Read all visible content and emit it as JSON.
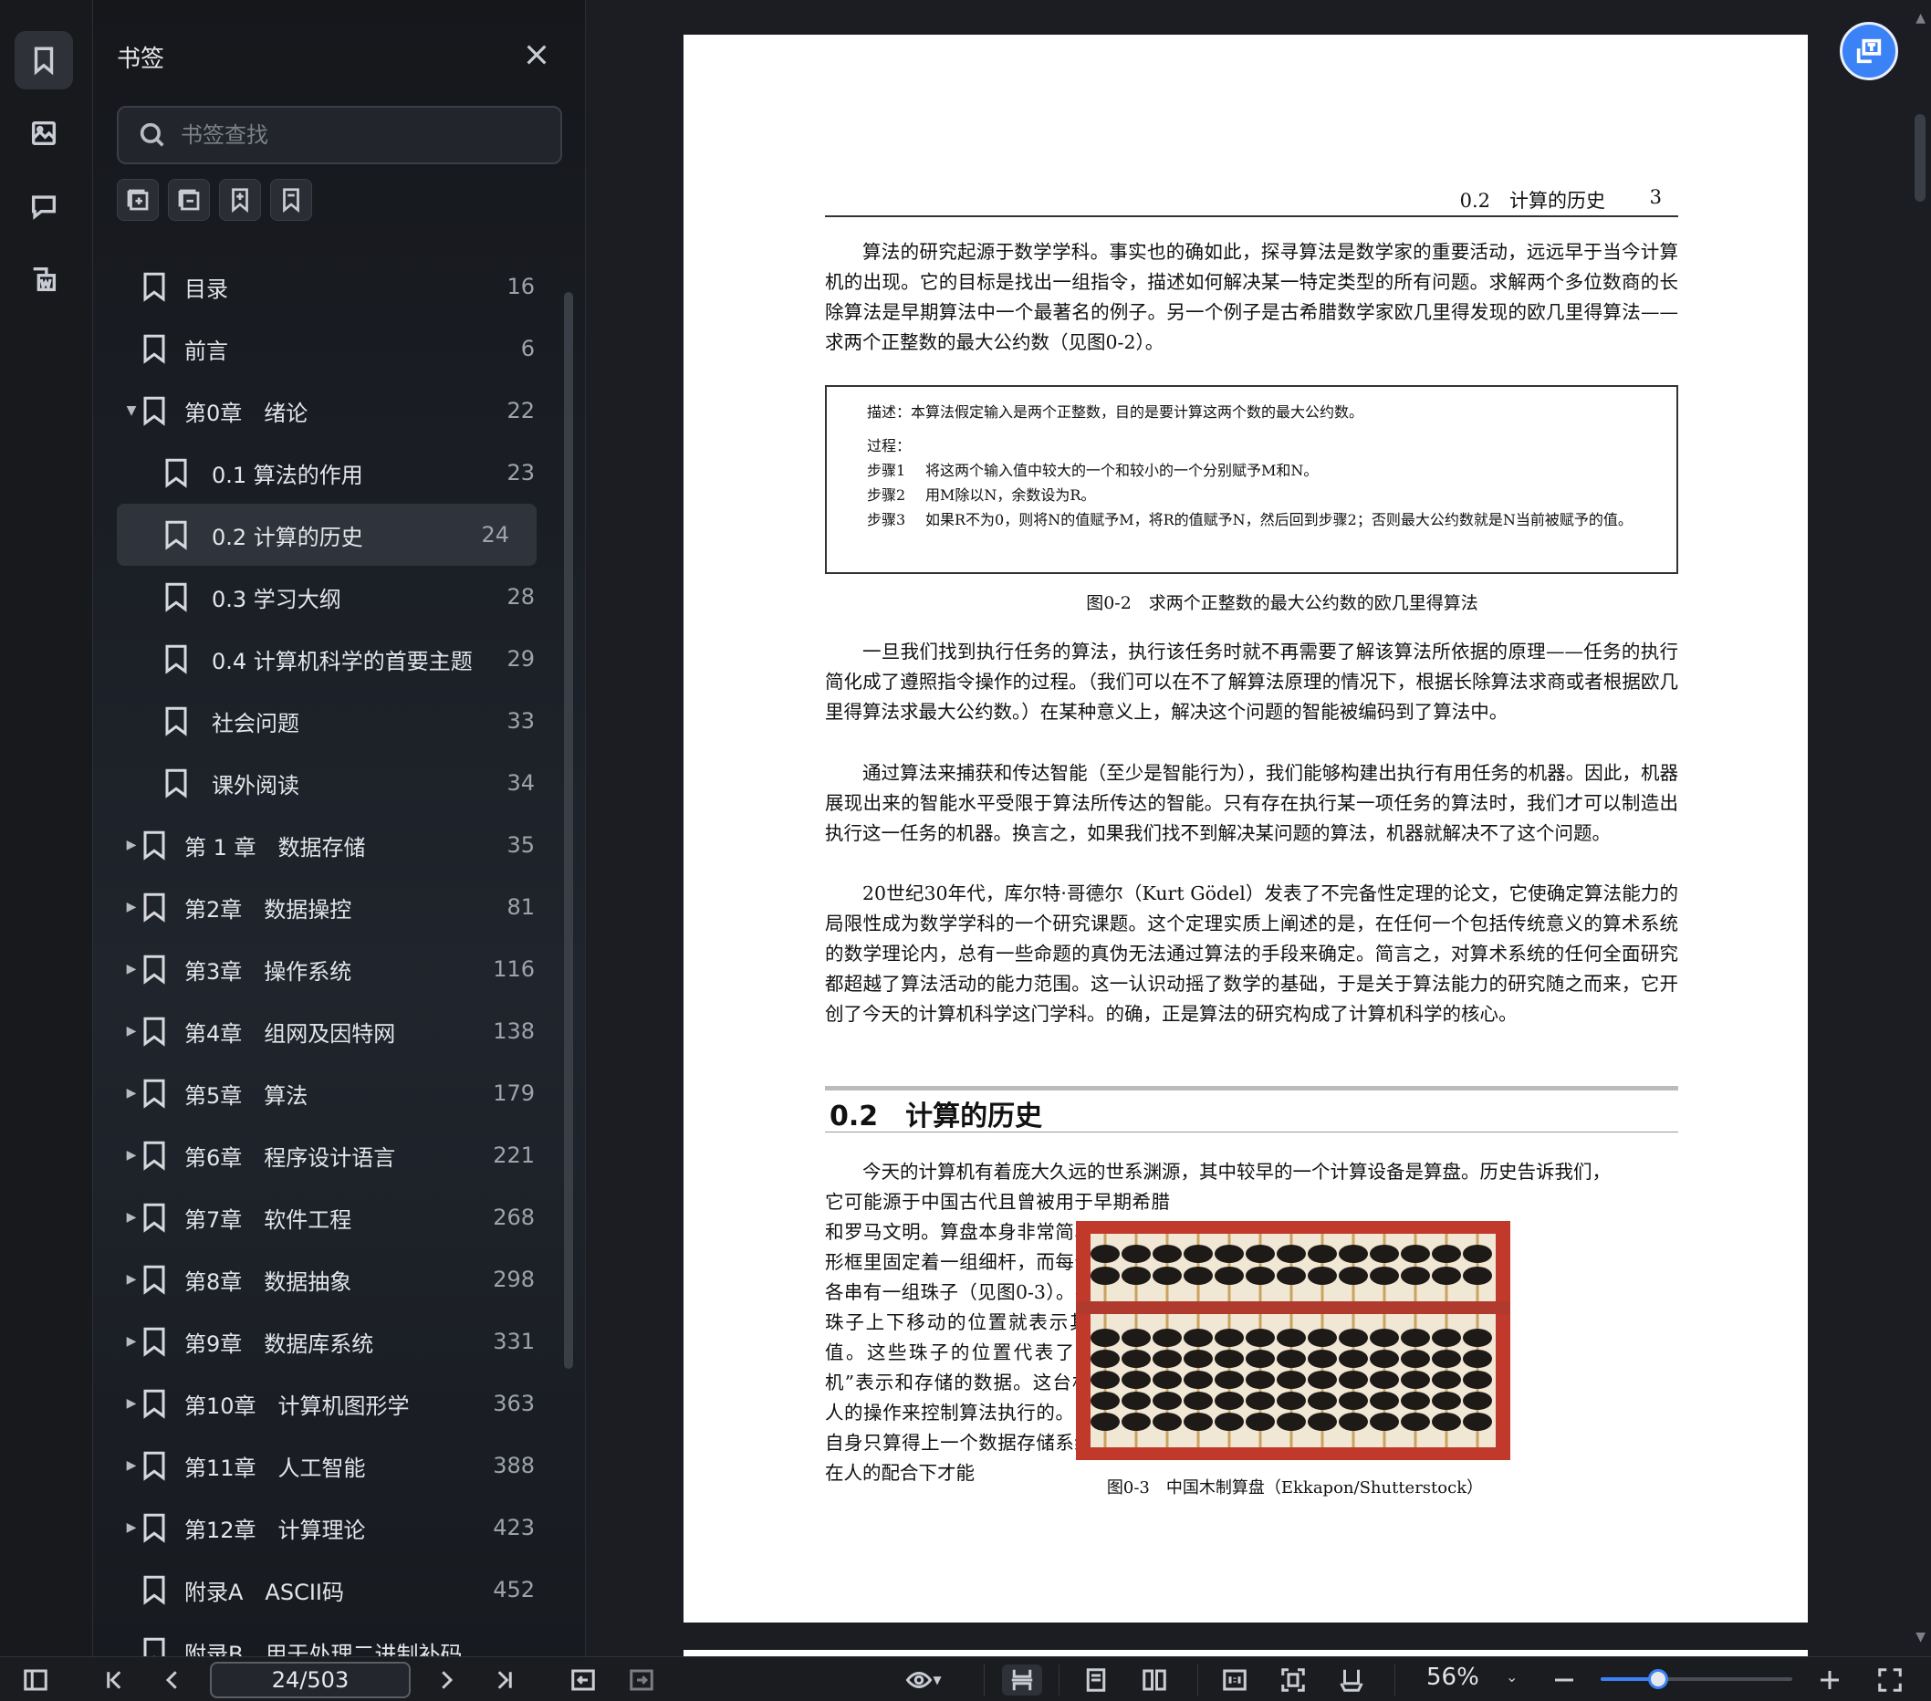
{
  "panel": {
    "title": "书签",
    "search_placeholder": "书签查找"
  },
  "bookmarks": [
    {
      "label": "目录",
      "page": "16",
      "level": 0,
      "arrow": ""
    },
    {
      "label": "前言",
      "page": "6",
      "level": 0,
      "arrow": ""
    },
    {
      "label": "第0章　绪论",
      "page": "22",
      "level": 0,
      "arrow": "▼"
    },
    {
      "label": "0.1 算法的作用",
      "page": "23",
      "level": 1,
      "arrow": ""
    },
    {
      "label": "0.2 计算的历史",
      "page": "24",
      "level": 1,
      "arrow": "",
      "selected": true
    },
    {
      "label": "0.3 学习大纲",
      "page": "28",
      "level": 1,
      "arrow": ""
    },
    {
      "label": "0.4 计算机科学的首要主题",
      "page": "29",
      "level": 1,
      "arrow": ""
    },
    {
      "label": "社会问题",
      "page": "33",
      "level": 1,
      "arrow": ""
    },
    {
      "label": "课外阅读",
      "page": "34",
      "level": 1,
      "arrow": ""
    },
    {
      "label": "第 1 章　数据存储",
      "page": "35",
      "level": 0,
      "arrow": "▶"
    },
    {
      "label": "第2章　数据操控",
      "page": "81",
      "level": 0,
      "arrow": "▶"
    },
    {
      "label": "第3章　操作系统",
      "page": "116",
      "level": 0,
      "arrow": "▶"
    },
    {
      "label": "第4章　组网及因特网",
      "page": "138",
      "level": 0,
      "arrow": "▶"
    },
    {
      "label": "第5章　算法",
      "page": "179",
      "level": 0,
      "arrow": "▶"
    },
    {
      "label": "第6章　程序设计语言",
      "page": "221",
      "level": 0,
      "arrow": "▶"
    },
    {
      "label": "第7章　软件工程",
      "page": "268",
      "level": 0,
      "arrow": "▶"
    },
    {
      "label": "第8章　数据抽象",
      "page": "298",
      "level": 0,
      "arrow": "▶"
    },
    {
      "label": "第9章　数据库系统",
      "page": "331",
      "level": 0,
      "arrow": "▶"
    },
    {
      "label": "第10章　计算机图形学",
      "page": "363",
      "level": 0,
      "arrow": "▶"
    },
    {
      "label": "第11章　人工智能",
      "page": "388",
      "level": 0,
      "arrow": "▶"
    },
    {
      "label": "第12章　计算理论",
      "page": "423",
      "level": 0,
      "arrow": "▶"
    },
    {
      "label": "附录A　ASCII码",
      "page": "452",
      "level": 0,
      "arrow": ""
    },
    {
      "label": "附录B　用于处理二进制补码",
      "page": "",
      "level": 0,
      "arrow": ""
    }
  ],
  "document": {
    "running_head_title": "0.2　计算的历史",
    "running_head_page": "3",
    "para1": "算法的研究起源于数学学科。事实也的确如此，探寻算法是数学家的重要活动，远远早于当今计算机的出现。它的目标是找出一组指令，描述如何解决某一特定类型的所有问题。求解两个多位数商的长除算法是早期算法中一个最著名的例子。另一个例子是古希腊数学家欧几里得发现的欧几里得算法——求两个正整数的最大公约数（见图0-2）。",
    "algo_desc": "描述：本算法假定输入是两个正整数，目的是要计算这两个数的最大公约数。",
    "algo_process": "过程：",
    "step1_label": "步骤1",
    "step1_text": "将这两个输入值中较大的一个和较小的一个分别赋予M和N。",
    "step2_label": "步骤2",
    "step2_text": "用M除以N，余数设为R。",
    "step3_label": "步骤3",
    "step3_text": "如果R不为0，则将N的值赋予M，将R的值赋予N，然后回到步骤2；否则最大公约数就是N当前被赋予的值。",
    "fig02_caption": "图0-2　求两个正整数的最大公约数的欧几里得算法",
    "para2": "一旦我们找到执行任务的算法，执行该任务时就不再需要了解该算法所依据的原理——任务的执行简化成了遵照指令操作的过程。（我们可以在不了解算法原理的情况下，根据长除算法求商或者根据欧几里得算法求最大公约数。）在某种意义上，解决这个问题的智能被编码到了算法中。",
    "para3": "通过算法来捕获和传达智能（至少是智能行为），我们能够构建出执行有用任务的机器。因此，机器展现出来的智能水平受限于算法所传达的智能。只有存在执行某一项任务的算法时，我们才可以制造出执行这一任务的机器。换言之，如果我们找不到解决某问题的算法，机器就解决不了这个问题。",
    "para4": "20世纪30年代，库尔特·哥德尔（Kurt Gödel）发表了不完备性定理的论文，它使确定算法能力的局限性成为数学学科的一个研究课题。这个定理实质上阐述的是，在任何一个包括传统意义的算术系统的数学理论内，总有一些命题的真伪无法通过算法的手段来确定。简言之，对算术系统的任何全面研究都超越了算法活动的能力范围。这一认识动摇了数学的基础，于是关于算法能力的研究随之而来，它开创了今天的计算机科学这门学科。的确，正是算法的研究构成了计算机科学的核心。",
    "section_title": "0.2　计算的历史",
    "para5": "今天的计算机有着庞大久远的世系渊源，其中较早的一个计算设备是算盘。历史告诉我们，",
    "para6": "它可能源于中国古代且曾被用于早期希腊和罗马文明。算盘本身非常简单，一个矩形框里固定着一组细杆，而每个细杆上又各串有一组珠子（见图0-3）。在细杆上，珠子上下移动的位置就表示其所存储的值。这些珠子的位置代表了这台“计算机”表示和存储的数据。这台机器是依靠人的操作来控制算法执行的。因此，算盘自身只算得上一个数据存储系统，它必须在人的配合下才能",
    "fig03_caption": "图0-3　中国木制算盘（Ekkapon/Shutterstock）"
  },
  "toolbar": {
    "page_value": "24/503",
    "zoom": "56%",
    "zoom_fraction": 0.3
  },
  "colors": {
    "accent": "#3b82f6",
    "panel_bg": "#1c2027",
    "selected_bg": "#2f333b"
  }
}
